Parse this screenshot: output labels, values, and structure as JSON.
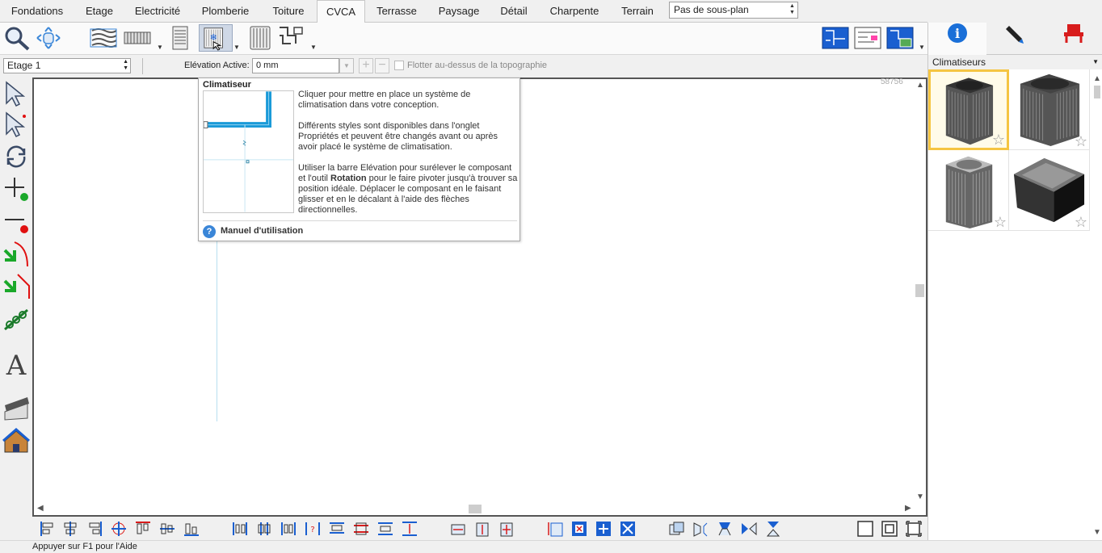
{
  "tabs": [
    {
      "label": "Fondations",
      "active": false
    },
    {
      "label": "Etage",
      "active": false
    },
    {
      "label": "Electricité",
      "active": false
    },
    {
      "label": "Plomberie",
      "active": false
    },
    {
      "label": "Toiture",
      "active": false
    },
    {
      "label": "CVCA",
      "active": true
    },
    {
      "label": "Terrasse",
      "active": false
    },
    {
      "label": "Paysage",
      "active": false
    },
    {
      "label": "Détail",
      "active": false
    },
    {
      "label": "Charpente",
      "active": false
    },
    {
      "label": "Terrain",
      "active": false
    }
  ],
  "subplan_select": "Pas de sous-plan",
  "toolbar": {
    "icons": [
      "zoom-icon",
      "pan-icon",
      "duct-icon",
      "radiator-baseboard-icon",
      "vent-icon",
      "air-conditioner-icon",
      "radiator-icon",
      "duct-route-icon",
      "plan-view-icon",
      "elevation-view-icon",
      "3d-view-icon"
    ]
  },
  "right_panel": {
    "tabs": [
      "info-icon",
      "pen-icon",
      "chair-icon"
    ],
    "category": "Climatiseurs",
    "items": [
      {
        "name": "air-conditioner-1",
        "selected": true
      },
      {
        "name": "air-conditioner-2",
        "selected": false
      },
      {
        "name": "air-conditioner-3",
        "selected": false
      },
      {
        "name": "air-conditioner-4",
        "selected": false
      }
    ]
  },
  "row2": {
    "floor_select": "Etage 1",
    "elevation_label": "Elévation Active:",
    "elevation_value": "0 mm",
    "float_label": "Flotter au-dessus de la topographie"
  },
  "canvas": {
    "corner_text": "58756"
  },
  "tooltip": {
    "title": "Climatiseur",
    "paragraph1": "Cliquer pour mettre en place un système de climatisation dans votre conception.",
    "paragraph2": "Différents styles sont disponibles dans l'onglet Propriétés et peuvent être changés avant ou après avoir placé le système de climatisation.",
    "paragraph3_a": "Utiliser la barre Elévation pour surélever le composant et l'outil ",
    "paragraph3_bold": "Rotation",
    "paragraph3_b": " pour le faire pivoter jusqu'à trouver sa position idéale. Déplacer le composant en le faisant glisser et en le décalant à l'aide des flèches directionnelles.",
    "help_label": "Manuel d'utilisation"
  },
  "status_text": "Appuyer sur F1 pour l'Aide",
  "colors": {
    "accent_blue": "#1a5fd0",
    "selection_gold": "#f5c542",
    "add_green": "#1aa82a",
    "delete_red": "#e01010"
  }
}
